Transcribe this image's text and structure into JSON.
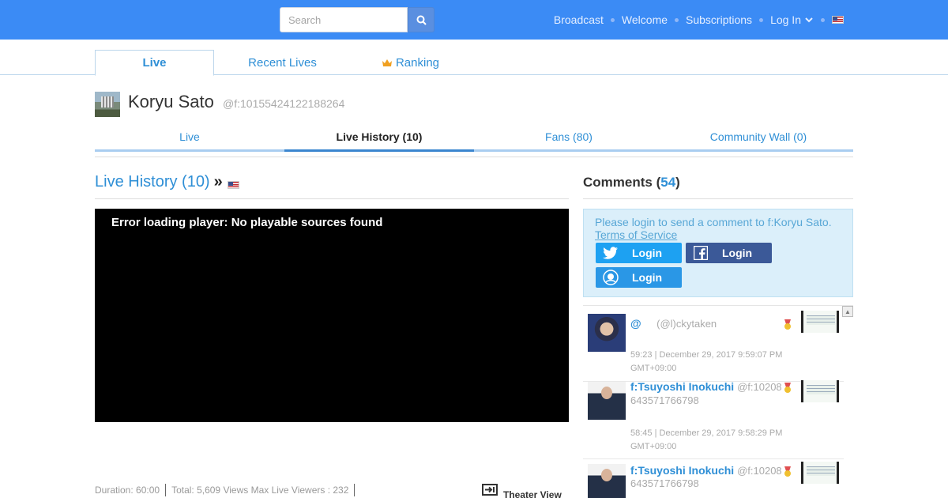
{
  "header": {
    "search_placeholder": "Search",
    "nav": [
      "Broadcast",
      "Welcome",
      "Subscriptions"
    ],
    "login": "Log In",
    "accent": "#3b8bf5"
  },
  "main_tabs": [
    "Live",
    "Recent Lives",
    "Ranking"
  ],
  "profile": {
    "name": "Koryu Sato",
    "id": "@f:10155424122188264"
  },
  "profile_tabs": [
    "Live",
    "Live History (10)",
    "Fans (80)",
    "Community Wall (0)"
  ],
  "live_history": {
    "title": "Live History (10)",
    "raquo": "»",
    "player_error": "Error loading player: No playable sources found",
    "duration": "Duration: 60:00",
    "totals": "Total: 5,609 Views Max Live Viewers : 232",
    "theater": "Theater View"
  },
  "comments": {
    "title": "Comments",
    "count": "54",
    "login_msg": "Please login to send a comment to f:Koryu Sato.",
    "tos": "Terms of Service",
    "twitter_login": "Login",
    "facebook_login": "Login",
    "twitcasting_login": "Login",
    "items": [
      {
        "name": "@",
        "handle": "(@l)ckytaken",
        "line2": "",
        "meta": "59:23 | December 29, 2017 9:59:07 PM GMT+09:00"
      },
      {
        "name": "f:Tsuyoshi Inokuchi",
        "handle": "@f:10208",
        "line2": "643571766798",
        "meta": "58:45 | December 29, 2017 9:58:29 PM GMT+09:00"
      },
      {
        "name": "f:Tsuyoshi Inokuchi",
        "handle": "@f:10208",
        "line2": "643571766798",
        "meta": ""
      }
    ]
  }
}
